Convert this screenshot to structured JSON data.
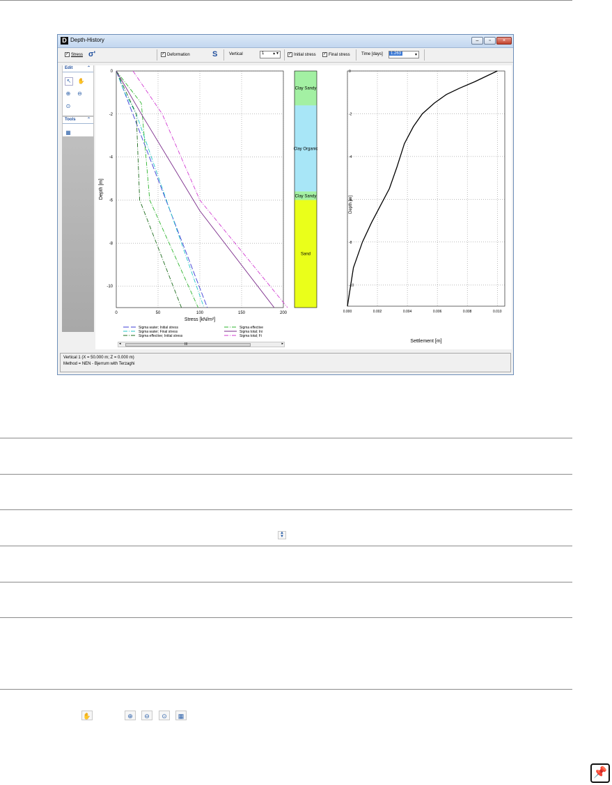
{
  "window": {
    "title": "Depth-History",
    "icon": "D"
  },
  "toolbar": {
    "stress_label": "Stress",
    "sigma_symbol": "σ'",
    "deformation_label": "Deformation",
    "s_symbol": "S",
    "vertical_label": "Vertical",
    "vertical_value": "1",
    "initial_stress_label": "Initial stress",
    "final_stress_label": "Final stress",
    "time_label": "Time [days]",
    "time_value": "1.263"
  },
  "sidebar": {
    "edit_label": "Edit",
    "tools_label": "Tools"
  },
  "stress_chart": {
    "xlabel": "Stress [kN/m²]",
    "ylabel": "Depth [m]",
    "x_ticks": [
      "0",
      "50",
      "100",
      "150",
      "200"
    ],
    "y_ticks": [
      "0",
      "-2",
      "-4",
      "-6",
      "-8",
      "-10"
    ],
    "legend": [
      {
        "label": "Sigma water; Initial stress",
        "color": "#3b3bd6",
        "dash": "8,3"
      },
      {
        "label": "Sigma effective",
        "color": "#2db52d",
        "dash": "6,2,1,2"
      },
      {
        "label": "Sigma water; Final stress",
        "color": "#22c7c7",
        "dash": "6,2,1,2"
      },
      {
        "label": "Sigma total; Ini",
        "color": "#7a2a8a",
        "dash": ""
      },
      {
        "label": "Sigma effective; Initial stress",
        "color": "#1a6a1a",
        "dash": "6,2,1,2"
      },
      {
        "label": "Sigma total; Fi",
        "color": "#d23ad2",
        "dash": "6,2,1,2"
      }
    ]
  },
  "soil_column": [
    {
      "name": "Clay Sandy",
      "color": "#a3f0a3",
      "top": 0,
      "bottom": -1.6
    },
    {
      "name": "Clay Organic",
      "color": "#a8e6f7",
      "top": -1.6,
      "bottom": -5.6
    },
    {
      "name": "Clay Sandy",
      "color": "#a3f0a3",
      "top": -5.6,
      "bottom": -6.0
    },
    {
      "name": "Sand",
      "color": "#eaff1a",
      "top": -6.0,
      "bottom": -11
    }
  ],
  "chart_data": [
    {
      "type": "line",
      "xlabel": "Stress [kN/m²]",
      "ylabel": "Depth [m]",
      "xlim": [
        0,
        200
      ],
      "ylim": [
        -11,
        0
      ],
      "series": [
        {
          "name": "Sigma water; Initial stress",
          "x": [
            0,
            109
          ],
          "y": [
            0,
            -11
          ]
        },
        {
          "name": "Sigma water; Final stress",
          "x": [
            0,
            10,
            24,
            105
          ],
          "y": [
            0,
            -1,
            -2,
            -11
          ]
        },
        {
          "name": "Sigma effective; Initial stress",
          "x": [
            0,
            24,
            28,
            78
          ],
          "y": [
            0,
            -2,
            -6,
            -11
          ]
        },
        {
          "name": "Sigma effective",
          "x": [
            0,
            30,
            40,
            98
          ],
          "y": [
            0,
            -1.5,
            -6,
            -11
          ]
        },
        {
          "name": "Sigma total; Ini",
          "x": [
            0,
            30,
            100,
            189
          ],
          "y": [
            0,
            -2,
            -6.5,
            -11
          ]
        },
        {
          "name": "Sigma total; Fi",
          "x": [
            20,
            55,
            100,
            205
          ],
          "y": [
            0,
            -2,
            -6,
            -11
          ]
        }
      ]
    },
    {
      "type": "line",
      "xlabel": "Settlement [m]",
      "ylabel": "Depth [m]",
      "xlim": [
        0,
        0.0105
      ],
      "ylim": [
        -11,
        0
      ],
      "x_ticks": [
        "0.000",
        "0.002",
        "0.004",
        "0.006",
        "0.008",
        "0.010"
      ],
      "y_ticks": [
        "0",
        "-2",
        "-4",
        "-6",
        "-8",
        "-10"
      ],
      "series": [
        {
          "name": "",
          "x": [
            0.01,
            0.0094,
            0.0085,
            0.0075,
            0.0066,
            0.0058,
            0.005,
            0.0044,
            0.0038,
            0.0033,
            0.0028,
            0.0022,
            0.0016,
            0.001,
            0.0004,
            0.0
          ],
          "y": [
            0,
            -0.2,
            -0.5,
            -0.8,
            -1.1,
            -1.5,
            -2.0,
            -2.6,
            -3.4,
            -4.5,
            -5.5,
            -6.3,
            -7.1,
            -8.0,
            -9.2,
            -11.0
          ]
        }
      ]
    }
  ],
  "status": {
    "line1": "Vertical 1 (X = 50.000 m; Z = 0.000 m)",
    "line2": "Method = NEN - Bjerrum with Terzaghi"
  },
  "scrollbar_grip": "III"
}
